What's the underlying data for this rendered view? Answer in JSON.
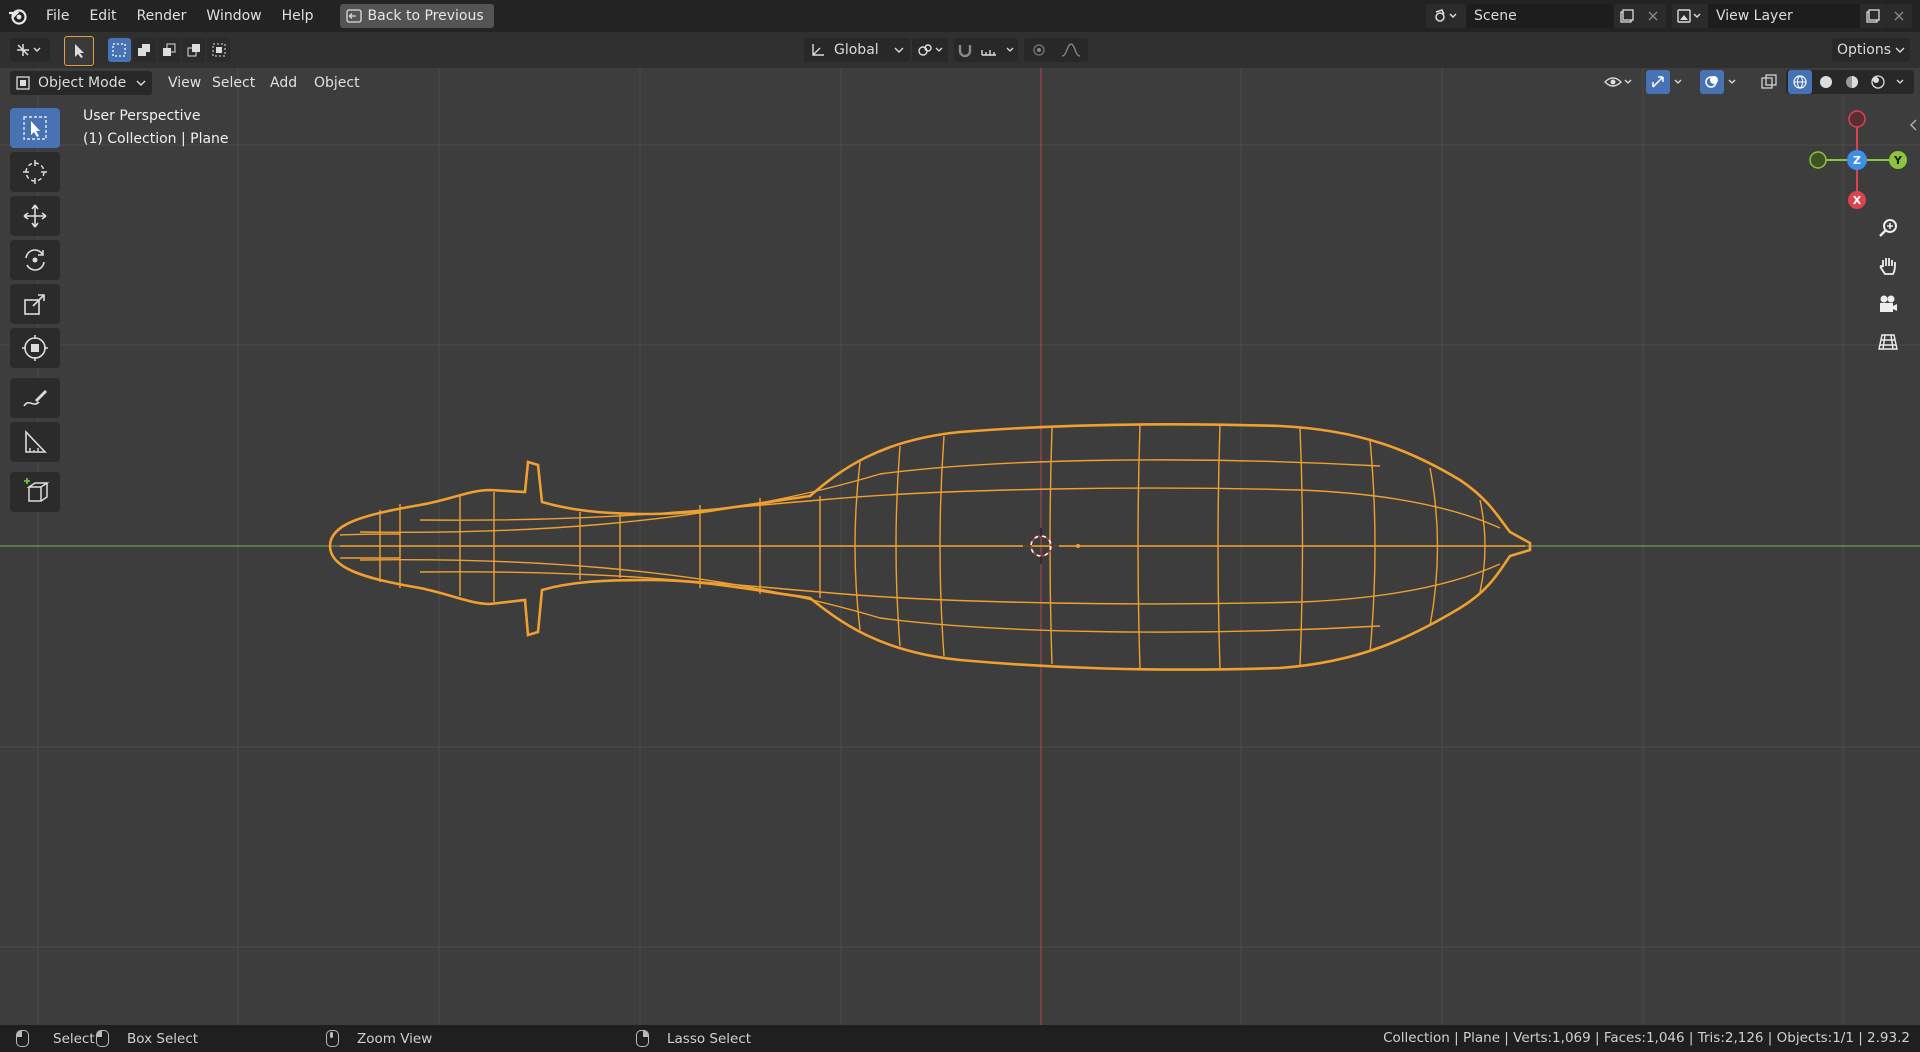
{
  "menu": [
    "File",
    "Edit",
    "Render",
    "Window",
    "Help"
  ],
  "back_button": "Back to Previous",
  "scene_name": "Scene",
  "view_layer_name": "View Layer",
  "transform_orientation": "Global",
  "options_label": "Options",
  "mode": "Object Mode",
  "view_menu": [
    "View",
    "Select",
    "Add",
    "Object"
  ],
  "viewport_info": {
    "line1": "User Perspective",
    "line2": "(1) Collection | Plane"
  },
  "gizmo": {
    "x": "X",
    "y": "Y",
    "z": "Z"
  },
  "status": {
    "select": "Select",
    "box_select": "Box Select",
    "zoom_view": "Zoom View",
    "lasso_select": "Lasso Select",
    "stats": "Collection | Plane | Verts:1,069 | Faces:1,046 | Tris:2,126 | Objects:1/1 | 2.93.2"
  },
  "colors": {
    "accent": "#4772b3",
    "selection": "#f0a030",
    "x_axis": "#d94450",
    "y_axis": "#8cc43c",
    "z_axis": "#3d8ee6"
  },
  "icons": [
    "blender-logo-icon",
    "back-icon",
    "scene-icon",
    "view-layer-icon",
    "editor-type-icon",
    "select-box-icon",
    "cursor-icon",
    "move-icon",
    "rotate-icon",
    "scale-icon",
    "transform-icon",
    "annotate-icon",
    "measure-icon",
    "add-cube-icon",
    "zoom-icon",
    "hand-pan-icon",
    "camera-icon",
    "grid-icon",
    "eye-icon",
    "gizmo-icon",
    "overlay-icon",
    "xray-icon",
    "wireframe-shading-icon",
    "solid-shading-icon",
    "material-shading-icon",
    "rendered-shading-icon"
  ]
}
